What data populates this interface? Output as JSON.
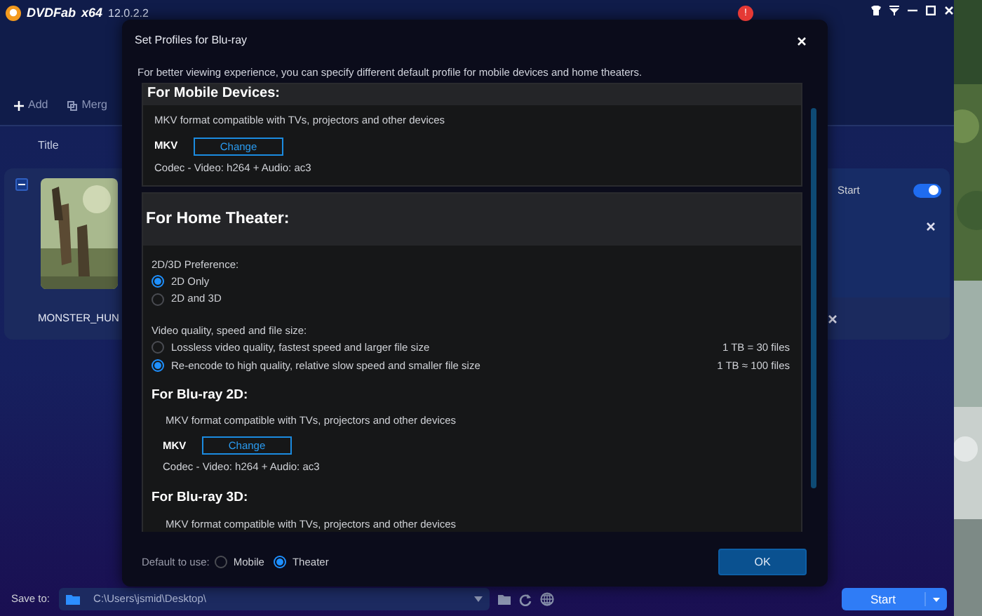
{
  "app": {
    "logo_text": "DVDFab",
    "edition": "x64",
    "version": "12.0.2.2",
    "notification_badge": "!"
  },
  "toolbar": [
    {
      "label": "Add"
    },
    {
      "label": "Merg"
    }
  ],
  "columns": [
    "Title"
  ],
  "titles": [
    {
      "name": "MONSTER_HUN",
      "option_label": "Start",
      "option_on": true
    }
  ],
  "modal": {
    "title": "Set Profiles for Blu-ray",
    "description": "For better viewing experience, you can specify different default profile for mobile devices and home theaters.",
    "mobile": {
      "heading": "For Mobile Devices:",
      "description": "MKV format compatible with TVs, projectors and other devices",
      "format": "MKV",
      "button": "Change",
      "codec": "Codec - Video: h264 + Audio: ac3"
    },
    "theater": {
      "heading": "For Home Theater:",
      "preference_label": "2D/3D Preference:",
      "preference_options": [
        {
          "label": "2D Only",
          "selected": true
        },
        {
          "label": "2D and 3D",
          "selected": false
        }
      ],
      "quality_label": "Video quality, speed and file size:",
      "quality_options": [
        {
          "label": "Lossless video quality, fastest speed and larger file size",
          "note": "1 TB = 30 files",
          "selected": false
        },
        {
          "label": "Re-encode to high quality, relative slow speed and smaller file size",
          "note": "1 TB ≈ 100 files",
          "selected": true
        }
      ],
      "profiles": [
        {
          "heading": "For Blu-ray 2D:",
          "description": "MKV format compatible with TVs, projectors and other devices",
          "format": "MKV",
          "button": "Change",
          "codec": "Codec - Video: h264 + Audio: ac3"
        },
        {
          "heading": "For Blu-ray 3D:",
          "description": "MKV format compatible with TVs, projectors and other devices"
        }
      ]
    },
    "default_label": "Default to use:",
    "default_options": [
      {
        "label": "Mobile",
        "selected": false
      },
      {
        "label": "Theater",
        "selected": true
      }
    ],
    "ok": "OK"
  },
  "save_bar": {
    "label": "Save to:",
    "path": "C:\\Users\\jsmid\\Desktop\\",
    "start": "Start"
  }
}
